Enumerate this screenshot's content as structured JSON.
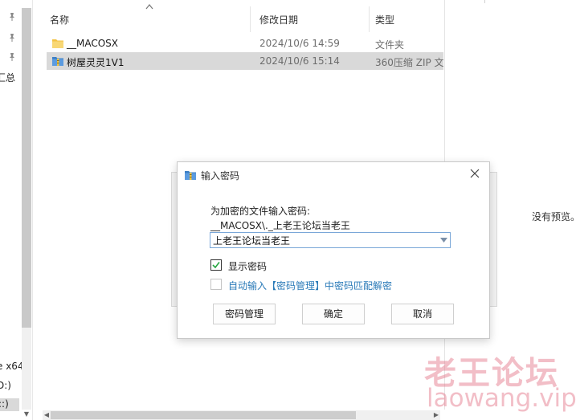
{
  "nav": {
    "partial_label_1": "汇总",
    "partial_label_2": "e x64",
    "partial_label_3": "D:)",
    "partial_label_4": "::)"
  },
  "file_list": {
    "columns": {
      "name": "名称",
      "modified": "修改日期",
      "type": "类型"
    },
    "rows": [
      {
        "name": "__MACOSX",
        "modified": "2024/10/6 14:59",
        "type": "文件夹",
        "icon": "folder-icon",
        "selected": false
      },
      {
        "name": "树屋灵灵1V1",
        "modified": "2024/10/6 15:14",
        "type": "360压缩 ZIP 文",
        "icon": "zip-archive-icon",
        "selected": true
      }
    ]
  },
  "preview": {
    "text": "没有预览。"
  },
  "dialog": {
    "title": "输入密码",
    "prompt": "为加密的文件输入密码:",
    "file_path": "__MACOSX\\._上老王论坛当老王",
    "password_value": "上老王论坛当老王",
    "show_password_label": "显示密码",
    "show_password_checked": true,
    "auto_input_label": "自动输入【密码管理】中密码匹配解密",
    "auto_input_checked": false,
    "buttons": {
      "manage": "密码管理",
      "ok": "确定",
      "cancel": "取消"
    }
  },
  "watermark": {
    "cn": "老王论坛",
    "en": "laowang.vip"
  },
  "colors": {
    "selection": "#d9d9d9",
    "link_blue": "#2a7ab8",
    "checkbox_green": "#26a641",
    "watermark": "#e26e82"
  }
}
